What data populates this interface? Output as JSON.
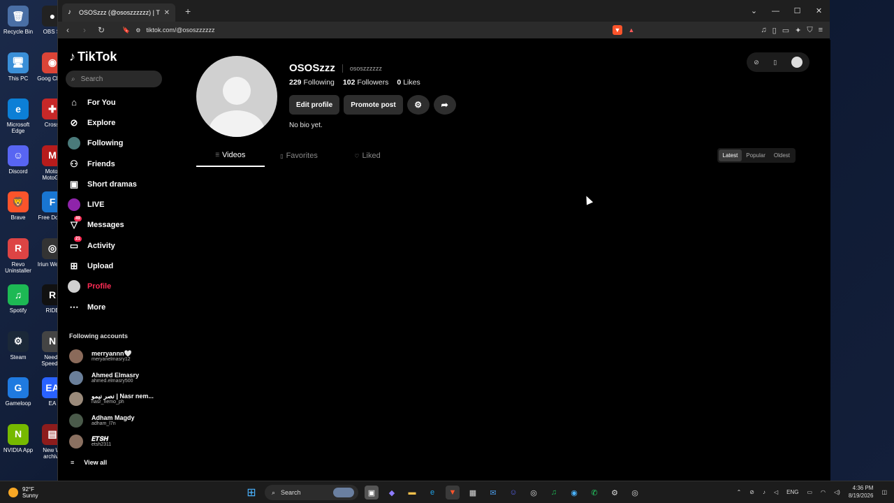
{
  "desktop": {
    "col1": [
      {
        "label": "Recycle Bin",
        "icon": "recycle-bin-icon",
        "color": "#4a6fa5",
        "glyph": "🗑"
      },
      {
        "label": "This PC",
        "icon": "computer-icon",
        "color": "#3a8fd8",
        "glyph": "🖥"
      },
      {
        "label": "Microsoft Edge",
        "icon": "edge-icon",
        "color": "#0c7fd6",
        "glyph": "e"
      },
      {
        "label": "Discord",
        "icon": "discord-icon",
        "color": "#5865f2",
        "glyph": "☺"
      },
      {
        "label": "Brave",
        "icon": "brave-icon",
        "color": "#fb542b",
        "glyph": "🦁"
      },
      {
        "label": "Revo Uninstaller",
        "icon": "revo-icon",
        "color": "#d44",
        "glyph": "R"
      },
      {
        "label": "Spotify",
        "icon": "spotify-icon",
        "color": "#1db954",
        "glyph": "♫"
      },
      {
        "label": "Steam",
        "icon": "steam-icon",
        "color": "#1b2838",
        "glyph": "⚙"
      },
      {
        "label": "Gameloop",
        "icon": "gameloop-icon",
        "color": "#1f7ae0",
        "glyph": "G"
      },
      {
        "label": "NVIDIA App",
        "icon": "nvidia-icon",
        "color": "#76b900",
        "glyph": "N"
      }
    ],
    "col2": [
      {
        "label": "OBS St",
        "icon": "obs-icon",
        "color": "#222",
        "glyph": "●"
      },
      {
        "label": "Goog Chron",
        "icon": "chrome-icon",
        "color": "#db4437",
        "glyph": "◉"
      },
      {
        "label": "Crossl",
        "icon": "crossfire-icon",
        "color": "#c62828",
        "glyph": "✚"
      },
      {
        "label": "Motor MotoGP",
        "icon": "motogp-icon",
        "color": "#b71c1c",
        "glyph": "M"
      },
      {
        "label": "Free Downl",
        "icon": "download-icon",
        "color": "#1976d2",
        "glyph": "F"
      },
      {
        "label": "Iriun Webca",
        "icon": "webcam-icon",
        "color": "#333",
        "glyph": "◎"
      },
      {
        "label": "RIDE",
        "icon": "ride-icon",
        "color": "#111",
        "glyph": "R"
      },
      {
        "label": "Need f Speed™",
        "icon": "nfs-icon",
        "color": "#444",
        "glyph": "N"
      },
      {
        "label": "EA",
        "icon": "ea-icon",
        "color": "#2962ff",
        "glyph": "EA"
      },
      {
        "label": "New Wi archive",
        "icon": "archive-icon",
        "color": "#8d1c1c",
        "glyph": "▤"
      }
    ]
  },
  "browser": {
    "tab_title": "OSOSzzz (@ososzzzzzz) | TikTok",
    "url": "tiktok.com/@ososzzzzzz"
  },
  "tiktok": {
    "logo": "TikTok",
    "search_placeholder": "Search",
    "menu": [
      {
        "label": "For You",
        "icon": "home-icon",
        "glyph": "⌂"
      },
      {
        "label": "Explore",
        "icon": "compass-icon",
        "glyph": "⊘"
      },
      {
        "label": "Following",
        "icon": "following-avatar-icon",
        "glyph": "●"
      },
      {
        "label": "Friends",
        "icon": "friends-icon",
        "glyph": "⚇"
      },
      {
        "label": "Short dramas",
        "icon": "film-icon",
        "glyph": "▣"
      },
      {
        "label": "LIVE",
        "icon": "live-icon",
        "glyph": "◉"
      },
      {
        "label": "Messages",
        "icon": "messages-icon",
        "glyph": "▽",
        "badge": "49"
      },
      {
        "label": "Activity",
        "icon": "activity-icon",
        "glyph": "▭",
        "badge": "21"
      },
      {
        "label": "Upload",
        "icon": "upload-icon",
        "glyph": "⊞"
      },
      {
        "label": "Profile",
        "icon": "profile-avatar-icon",
        "glyph": "●"
      },
      {
        "label": "More",
        "icon": "more-icon",
        "glyph": "⋯"
      }
    ],
    "following_title": "Following accounts",
    "following": [
      {
        "name": "merryannn🤍",
        "handle": "meryanelmasry12",
        "color": "#8a6a5a"
      },
      {
        "name": "Ahmed Elmasry",
        "handle": "ahmed.elmasry500",
        "color": "#6a7f9a"
      },
      {
        "name": "نصر نيمو | Nasr nem...",
        "handle": "nasr_nemo_ph",
        "color": "#9a8a7a"
      },
      {
        "name": "Adham Magdy",
        "handle": "adham_l7n",
        "color": "#4a5a4a"
      },
      {
        "name": "𝑬𝑻𝑺𝑯",
        "handle": "etsh2311",
        "color": "#8a7060"
      }
    ],
    "view_all": "View all",
    "profile": {
      "display_name": "OSOSzzz",
      "handle": "ososzzzzzz",
      "following_count": "229",
      "following_label": "Following",
      "followers_count": "102",
      "followers_label": "Followers",
      "likes_count": "0",
      "likes_label": "Likes",
      "edit_label": "Edit profile",
      "promote_label": "Promote post",
      "bio": "No bio yet."
    },
    "tabs": [
      {
        "label": "Videos",
        "glyph": "⦙⦙⦙"
      },
      {
        "label": "Favorites",
        "glyph": "▯"
      },
      {
        "label": "Liked",
        "glyph": "♡"
      }
    ],
    "sort": [
      "Latest",
      "Popular",
      "Oldest"
    ]
  },
  "taskbar": {
    "temp": "92°F",
    "weather": "Sunny",
    "search": "Search",
    "lang": "ENG",
    "time": "4:36 PM",
    "date": "8/19/2026"
  }
}
